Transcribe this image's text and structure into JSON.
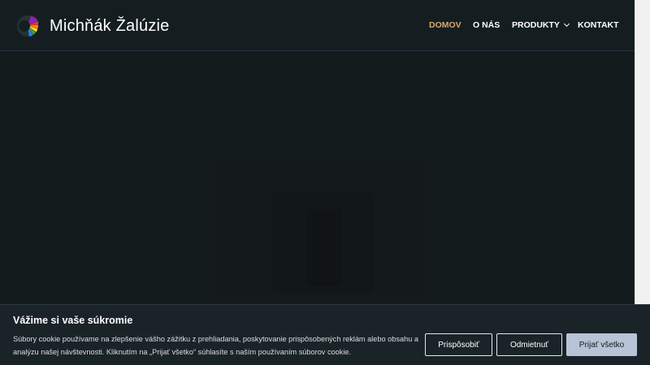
{
  "header": {
    "brand": "Michňák Žalúzie",
    "nav": [
      {
        "label": "DOMOV",
        "active": true
      },
      {
        "label": "O NÁS",
        "active": false
      },
      {
        "label": "PRODUKTY",
        "active": false,
        "dropdown": true
      },
      {
        "label": "KONTAKT",
        "active": false
      }
    ]
  },
  "cookie_banner": {
    "title": "Vážime si vaše súkromie",
    "text": "Súbory cookie používame na zlepšenie vášho zážitku z prehliadania, poskytovanie prispôsobených reklám alebo obsahu a analýzu našej návštevnosti. Kliknutím na „Prijať všetko“ súhlasíte s naším používaním súborov cookie.",
    "buttons": {
      "customize": "Prispôsobiť",
      "reject": "Odmietnuť",
      "accept": "Prijať všetko"
    }
  },
  "colors": {
    "page_bg": "#141c1e",
    "nav_active": "#d9a86a",
    "accept_button": "#b7c3d6"
  },
  "icons": {
    "logo": "colorful-blinds-logo-icon",
    "dropdown": "chevron-down-icon"
  }
}
